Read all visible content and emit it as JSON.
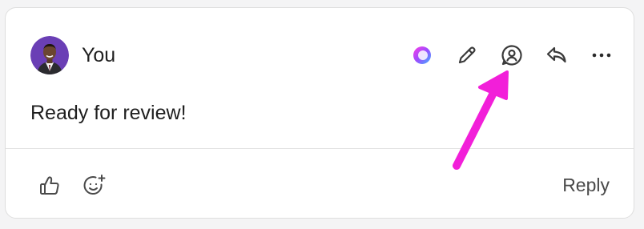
{
  "comment": {
    "author": "You",
    "message": "Ready for review!"
  },
  "toolbar": {
    "icons": [
      "copilot-icon",
      "edit-icon",
      "mention-icon",
      "reply-arrow-icon",
      "more-options-icon"
    ]
  },
  "footer": {
    "reply_label": "Reply",
    "icons": [
      "like-icon",
      "add-reaction-icon"
    ]
  },
  "colors": {
    "avatar_bg": "#6a3fb5",
    "annotation_arrow": "#f21fd9",
    "icon_stroke": "#3a3a3a"
  }
}
